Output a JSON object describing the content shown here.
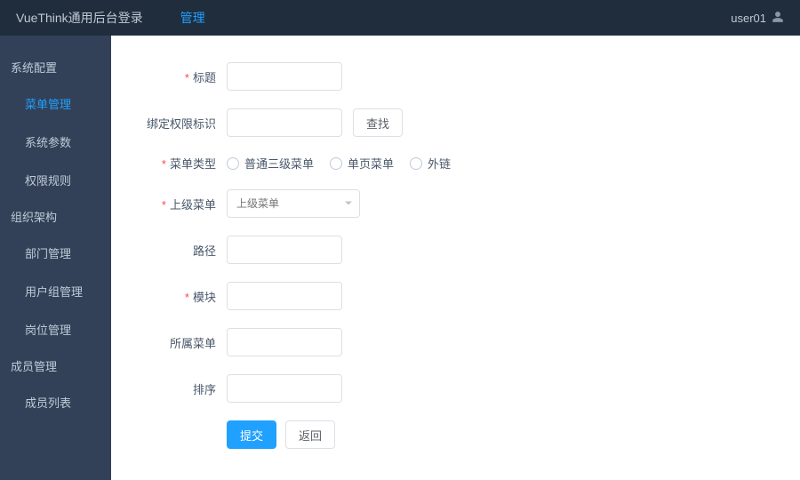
{
  "header": {
    "brand": "VueThink通用后台登录",
    "nav_item": "管理",
    "username": "user01"
  },
  "sidebar": {
    "groups": [
      {
        "title": "系统配置",
        "items": [
          {
            "label": "菜单管理",
            "active": true
          },
          {
            "label": "系统参数",
            "active": false
          },
          {
            "label": "权限规则",
            "active": false
          }
        ]
      },
      {
        "title": "组织架构",
        "items": [
          {
            "label": "部门管理",
            "active": false
          },
          {
            "label": "用户组管理",
            "active": false
          },
          {
            "label": "岗位管理",
            "active": false
          }
        ]
      },
      {
        "title": "成员管理",
        "items": [
          {
            "label": "成员列表",
            "active": false
          }
        ]
      }
    ]
  },
  "form": {
    "title_label": "标题",
    "permission_label": "绑定权限标识",
    "find_button": "查找",
    "menu_type_label": "菜单类型",
    "menu_type_options": [
      "普通三级菜单",
      "单页菜单",
      "外链"
    ],
    "parent_menu_label": "上级菜单",
    "parent_menu_placeholder": "上级菜单",
    "path_label": "路径",
    "module_label": "模块",
    "belong_menu_label": "所属菜单",
    "sort_label": "排序",
    "submit_button": "提交",
    "back_button": "返回"
  }
}
